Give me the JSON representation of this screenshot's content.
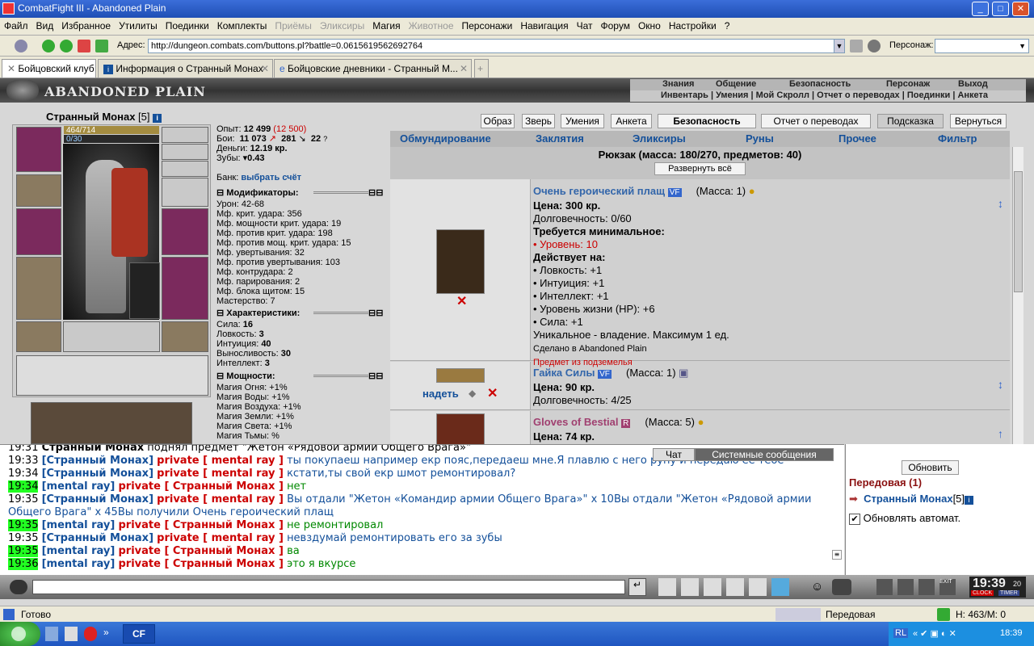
{
  "window": {
    "title": "CombatFight III - Abandoned Plain"
  },
  "menu": {
    "items": [
      "Файл",
      "Вид",
      "Избранное",
      "Утилиты",
      "Поединки",
      "Комплекты",
      "Приёмы",
      "Эликсиры",
      "Магия",
      "Животное",
      "Персонажи",
      "Навигация",
      "Чат",
      "Форум",
      "Окно",
      "Настройки",
      "?"
    ],
    "disabled": [
      "Приёмы",
      "Эликсиры",
      "Животное"
    ]
  },
  "address": {
    "label": "Адрес:",
    "url": "http://dungeon.combats.com/buttons.pl?battle=0.0615619562692764",
    "persona_label": "Персонаж:"
  },
  "tabs": [
    {
      "label": "Бойцовский клуб"
    },
    {
      "label": "Информация о Странный Монах"
    },
    {
      "label": "Бойцовские дневники - Странный М..."
    }
  ],
  "game": {
    "logo": "ABANDONED PLAIN",
    "nav_top": [
      "Знания",
      "Общение",
      "Безопасность",
      "Персонаж",
      "Выход"
    ],
    "nav_bottom": "Инвентарь | Умения | Мой Скролл | Отчет о переводах | Поединки | Анкета"
  },
  "character": {
    "name": "Странный Монах",
    "level": "[5]",
    "hp": "464/714",
    "mana": "0/30",
    "exp_label": "Опыт:",
    "exp": "12 499",
    "exp_next": "(12 500)",
    "battles_label": "Бои:",
    "battles": "11 073",
    "wins": "281",
    "losses": "22",
    "money_label": "Деньги:",
    "money": "12.19 кр.",
    "teeth_label": "Зубы:",
    "teeth": "0.43",
    "bank_label": "Банк:",
    "bank_link": "выбрать счёт"
  },
  "modifiers": {
    "title": "Модификаторы:",
    "lines": [
      "Урон: 42-68",
      "Мф. крит. удара: 356",
      "Мф. мощности крит. удара: 19",
      "Мф. против крит. удара: 198",
      "Мф. против мощ. крит. удара: 15",
      "Мф. увертывания: 32",
      "Мф. против увертывания: 103",
      "Мф. контрудара: 2",
      "Мф. парирования: 2",
      "Мф. блока щитом: 15",
      "Мастерство: 7"
    ]
  },
  "characteristics": {
    "title": "Характеристики:",
    "lines": [
      {
        "k": "Сила: ",
        "v": "16"
      },
      {
        "k": "Ловкость: ",
        "v": "3"
      },
      {
        "k": "Интуиция: ",
        "v": "40"
      },
      {
        "k": "Выносливость: ",
        "v": "30"
      },
      {
        "k": "Интеллект: ",
        "v": "3"
      }
    ]
  },
  "powers": {
    "title": "Мощности:",
    "lines": [
      "Магия Огня: +1%",
      "Магия Воды: +1%",
      "Магия Воздуха: +1%",
      "Магия Земли: +1%",
      "Магия Света: +1%",
      "Магия Тьмы: %"
    ]
  },
  "topbuttons": [
    "Образ",
    "Зверь",
    "Умения",
    "Анкета",
    "Безопасность",
    "Отчет о переводах",
    "Подсказка",
    "Вернуться"
  ],
  "subtabs": [
    "Обмундирование",
    "Заклятия",
    "Эликсиры",
    "Руны",
    "Прочее",
    "Фильтр"
  ],
  "bag": {
    "title": "Рюкзак (масса: 180/270, предметов: 40)",
    "expand": "Развернуть всё"
  },
  "items": [
    {
      "name": "Очень героический плащ",
      "badge": "VF",
      "mass": "(Масса: 1)",
      "price": "Цена: 300 кр.",
      "dur": "Долговечность: 0/60",
      "req_title": "Требуется минимальное:",
      "req": "• Уровень: 10",
      "acts_title": "Действует на:",
      "acts": [
        "• Ловкость: +1",
        "• Интуиция: +1",
        "• Интеллект: +1",
        "• Уровень жизни (HP): +6",
        "• Сила: +1"
      ],
      "unique": "Уникальное - владение. Максимум 1 ед.",
      "made": "Сделано в Abandoned Plain",
      "dungeon": "Предмет из подземелья"
    },
    {
      "name": "Гайка Силы",
      "badge": "VF",
      "mass": "(Масса: 1)",
      "price": "Цена: 90 кр.",
      "dur": "Долговечность: 4/25",
      "wear": "надеть"
    },
    {
      "name": "Gloves of Bestial",
      "badge": "R",
      "mass": "(Масса: 5)",
      "price": "Цена: 74 кр."
    }
  ],
  "chat": {
    "tab_chat": "Чат",
    "tab_system": "Системные сообщения",
    "lines": [
      {
        "t": "19:31",
        "g": false,
        "who": "Странный Монах",
        "text": " поднял предмет \"Жетон «Рядовой армии Общего Врага»\""
      },
      {
        "t": "19:33",
        "g": false,
        "who": "[Странный Монах]",
        "pv": "private [ mental ray ]",
        "text": " ты покупаеш например екр пояс,передаеш мне.Я плавлю с него руну и передаю ее тебе"
      },
      {
        "t": "19:34",
        "g": false,
        "who": "[Странный Монах]",
        "pv": "private [ mental ray ]",
        "text": " кстати,ты свой екр шмот ремонтировал?"
      },
      {
        "t": "19:34",
        "g": true,
        "who": "[mental ray]",
        "pv": "private [ Странный Монах ]",
        "text": " нет"
      },
      {
        "t": "19:35",
        "g": false,
        "who": "[Странный Монах]",
        "pv": "private [ mental ray ]",
        "text": " Вы отдали \"Жетон «Командир армии Общего Врага»\" x 10Вы отдали \"Жетон «Рядовой армии"
      },
      {
        "t": "",
        "g": false,
        "who": "",
        "pv": "",
        "text": "Общего Врага\" x 45Вы получили Очень героический плащ"
      },
      {
        "t": "19:35",
        "g": true,
        "who": "[mental ray]",
        "pv": "private [ Странный Монах ]",
        "text": " не ремонтировал"
      },
      {
        "t": "19:35",
        "g": false,
        "who": "[Странный Монах]",
        "pv": "private [ mental ray ]",
        "text": " невздумай ремонтировать его за зубы"
      },
      {
        "t": "19:35",
        "g": true,
        "who": "[mental ray]",
        "pv": "private [ Странный Монах ]",
        "text": " ва"
      },
      {
        "t": "19:36",
        "g": true,
        "who": "[mental ray]",
        "pv": "private [ Странный Монах ]",
        "text": " это я вкурсе"
      }
    ]
  },
  "online": {
    "refresh": "Обновить",
    "location": "Передовая (1)",
    "user": "Странный Монах",
    "user_level": "[5]",
    "auto": "Обновлять автомат."
  },
  "clock": {
    "time": "19:39",
    "sec": "20",
    "label1": "CLOCK",
    "label2": "TIMER"
  },
  "status": {
    "ready": "Готово",
    "zone": "Передовая",
    "mem": "Н: 463/М: 0"
  },
  "taskbar": {
    "lang": "RL",
    "time": "18:39",
    "app": "CF"
  },
  "colors": {
    "link": "#14509a",
    "private": "#cc0000",
    "highlight": "#22ff22"
  }
}
